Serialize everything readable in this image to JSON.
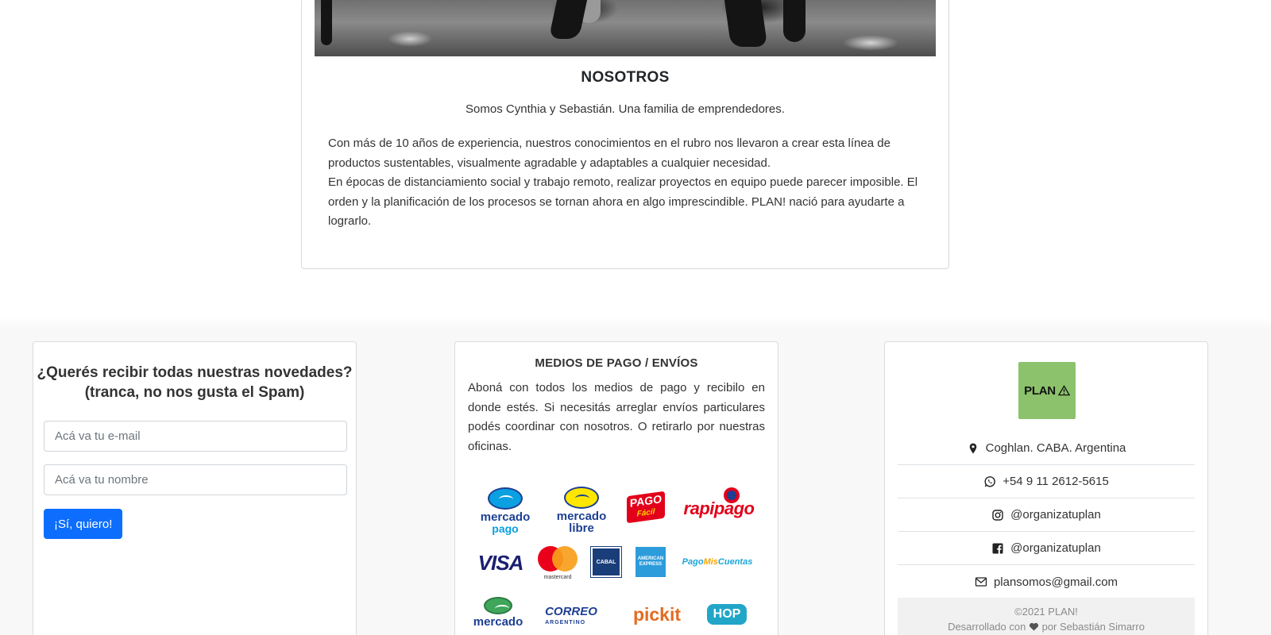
{
  "about": {
    "title": "NOSOTROS",
    "lead": "Somos Cynthia y Sebastián. Una familia de emprendedores.",
    "paragraph_1": "Con más de 10 años de experiencia, nuestros conocimientos en el rubro nos llevaron a crear esta línea de productos sustentables, visualmente agradable y adaptables a cualquier necesidad.",
    "paragraph_2": "En épocas de distanciamiento social y trabajo remoto, realizar proyectos en equipo puede parecer imposible. El orden y la planificación de los procesos se tornan ahora en algo imprescindible. PLAN! nació para ayudarte a lograrlo."
  },
  "newsletter": {
    "title_line_1": "¿Querés recibir todas nuestras novedades?",
    "title_line_2": "(tranca, no nos gusta el Spam)",
    "email_placeholder": "Acá va tu e-mail",
    "name_placeholder": "Acá va tu nombre",
    "submit_label": "¡Sí, quiero!"
  },
  "payments": {
    "title": "MEDIOS DE PAGO / ENVÍOS",
    "text": "Aboná con todos los medios de pago y recibilo en donde estés. Si necesitás arreglar envíos particulares podés coordinar con nosotros. O retirarlo por nuestras oficinas.",
    "logos": {
      "mercadopago_1": "mercado",
      "mercadopago_2": "pago",
      "mercadolibre_1": "mercado",
      "mercadolibre_2": "libre",
      "pagofacil_1": "PAGO",
      "pagofacil_2": "Fácil",
      "rapipago": "rapipago",
      "visa": "VISA",
      "mastercard": "mastercard",
      "cabal": "CABAL",
      "amex": "AMERICAN EXPRESS",
      "pagomiscuentas_1": "Pago",
      "pagomiscuentas_2": "Mis",
      "pagomiscuentas_3": "Cuentas",
      "mercadoenvios": "mercado",
      "correo_1": "CORREO",
      "correo_2": "ARGENTINO",
      "pickit": "pickit",
      "hop": "HOP"
    }
  },
  "contact": {
    "logo_text": "PLAN",
    "items": [
      {
        "icon": "map-marker-icon",
        "text": "Coghlan. CABA. Argentina"
      },
      {
        "icon": "whatsapp-icon",
        "text": "+54 9 11 2612-5615"
      },
      {
        "icon": "instagram-icon",
        "text": "@organizatuplan"
      },
      {
        "icon": "facebook-icon",
        "text": "@organizatuplan"
      },
      {
        "icon": "envelope-icon",
        "text": "plansomos@gmail.com"
      }
    ],
    "copyright": "©2021 PLAN!",
    "credit_prefix": "Desarrollado con",
    "credit_suffix": "por Sebastián Simarro"
  },
  "colors": {
    "primary_button": "#0d6efd",
    "plan_logo_bg": "#8cc26b",
    "footer_bg": "#f8f8f8"
  }
}
